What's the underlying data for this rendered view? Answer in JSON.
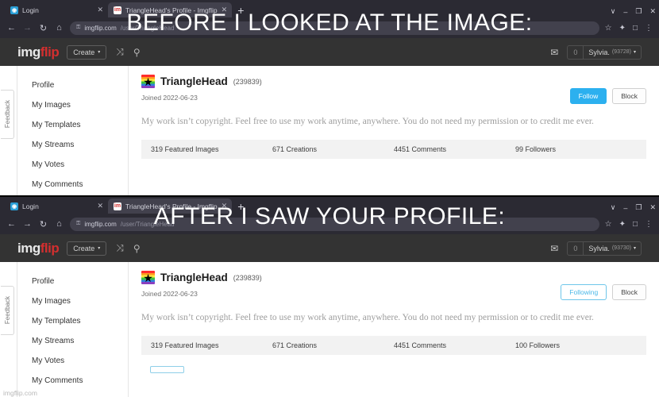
{
  "meme": {
    "caption_top": "BEFORE I LOOKED AT THE IMAGE:",
    "caption_bottom": "AFTER I SAW YOUR PROFILE:",
    "watermark": "imgflip.com"
  },
  "colors": {
    "accent_blue": "#2cb0ef",
    "brand_red": "#d32f2f",
    "chrome_bg": "#2b2a33",
    "header_bg": "#333333"
  },
  "browser": {
    "tabs": [
      {
        "title": "Login",
        "favicon": "login-favicon",
        "favicon_glyph": "◉",
        "close": "✕"
      },
      {
        "title": "TriangleHead's Profile - Imgflip",
        "favicon": "imgflip-favicon",
        "favicon_glyph": "im",
        "close": "✕"
      }
    ],
    "new_tab": "+",
    "window_controls": {
      "list": "∨",
      "minimize": "–",
      "maximize": "❐",
      "close": "✕"
    },
    "nav": {
      "back": "←",
      "forward": "→",
      "refresh": "↻",
      "home": "⌂",
      "lock": "⚿",
      "url_domain": "imgflip.com",
      "url_path": "/user/TriangleHead",
      "bookmark": "☆",
      "extensions": "✦",
      "profile": "□",
      "menu": "⋮"
    }
  },
  "site_header": {
    "logo_img": "img",
    "logo_flip": "flip",
    "create_label": "Create",
    "create_caret": "▾",
    "shuffle_icon": "⤨",
    "search_icon": "⚲",
    "mail_icon": "✉",
    "notification_count": "0",
    "user_top": {
      "name": "Sylvia.",
      "points": "(93728)"
    },
    "user_bottom": {
      "name": "Sylvia.",
      "points": "(93730)"
    },
    "user_caret": "▾"
  },
  "feedback_tab": "Feedback",
  "sidebar": {
    "items": [
      {
        "label": "Profile"
      },
      {
        "label": "My Images"
      },
      {
        "label": "My Templates"
      },
      {
        "label": "My Streams"
      },
      {
        "label": "My Votes"
      },
      {
        "label": "My Comments"
      }
    ]
  },
  "profile": {
    "avatar_glyph": "★",
    "username": "TriangleHead",
    "points": "(239839)",
    "joined": "Joined 2022-06-23",
    "bio": "My work isn’t copyright. Feel free to use my work anytime, anywhere. You do not need my permission or to credit me ever.",
    "buttons_top": {
      "follow": "Follow",
      "block": "Block"
    },
    "buttons_bottom": {
      "follow": "Following",
      "block": "Block"
    },
    "stats_top": [
      {
        "label": "319 Featured Images"
      },
      {
        "label": "671 Creations"
      },
      {
        "label": "4451 Comments"
      },
      {
        "label": "99 Followers"
      }
    ],
    "stats_bottom": [
      {
        "label": "319 Featured Images"
      },
      {
        "label": "671 Creations"
      },
      {
        "label": "4451 Comments"
      },
      {
        "label": "100 Followers"
      }
    ]
  }
}
